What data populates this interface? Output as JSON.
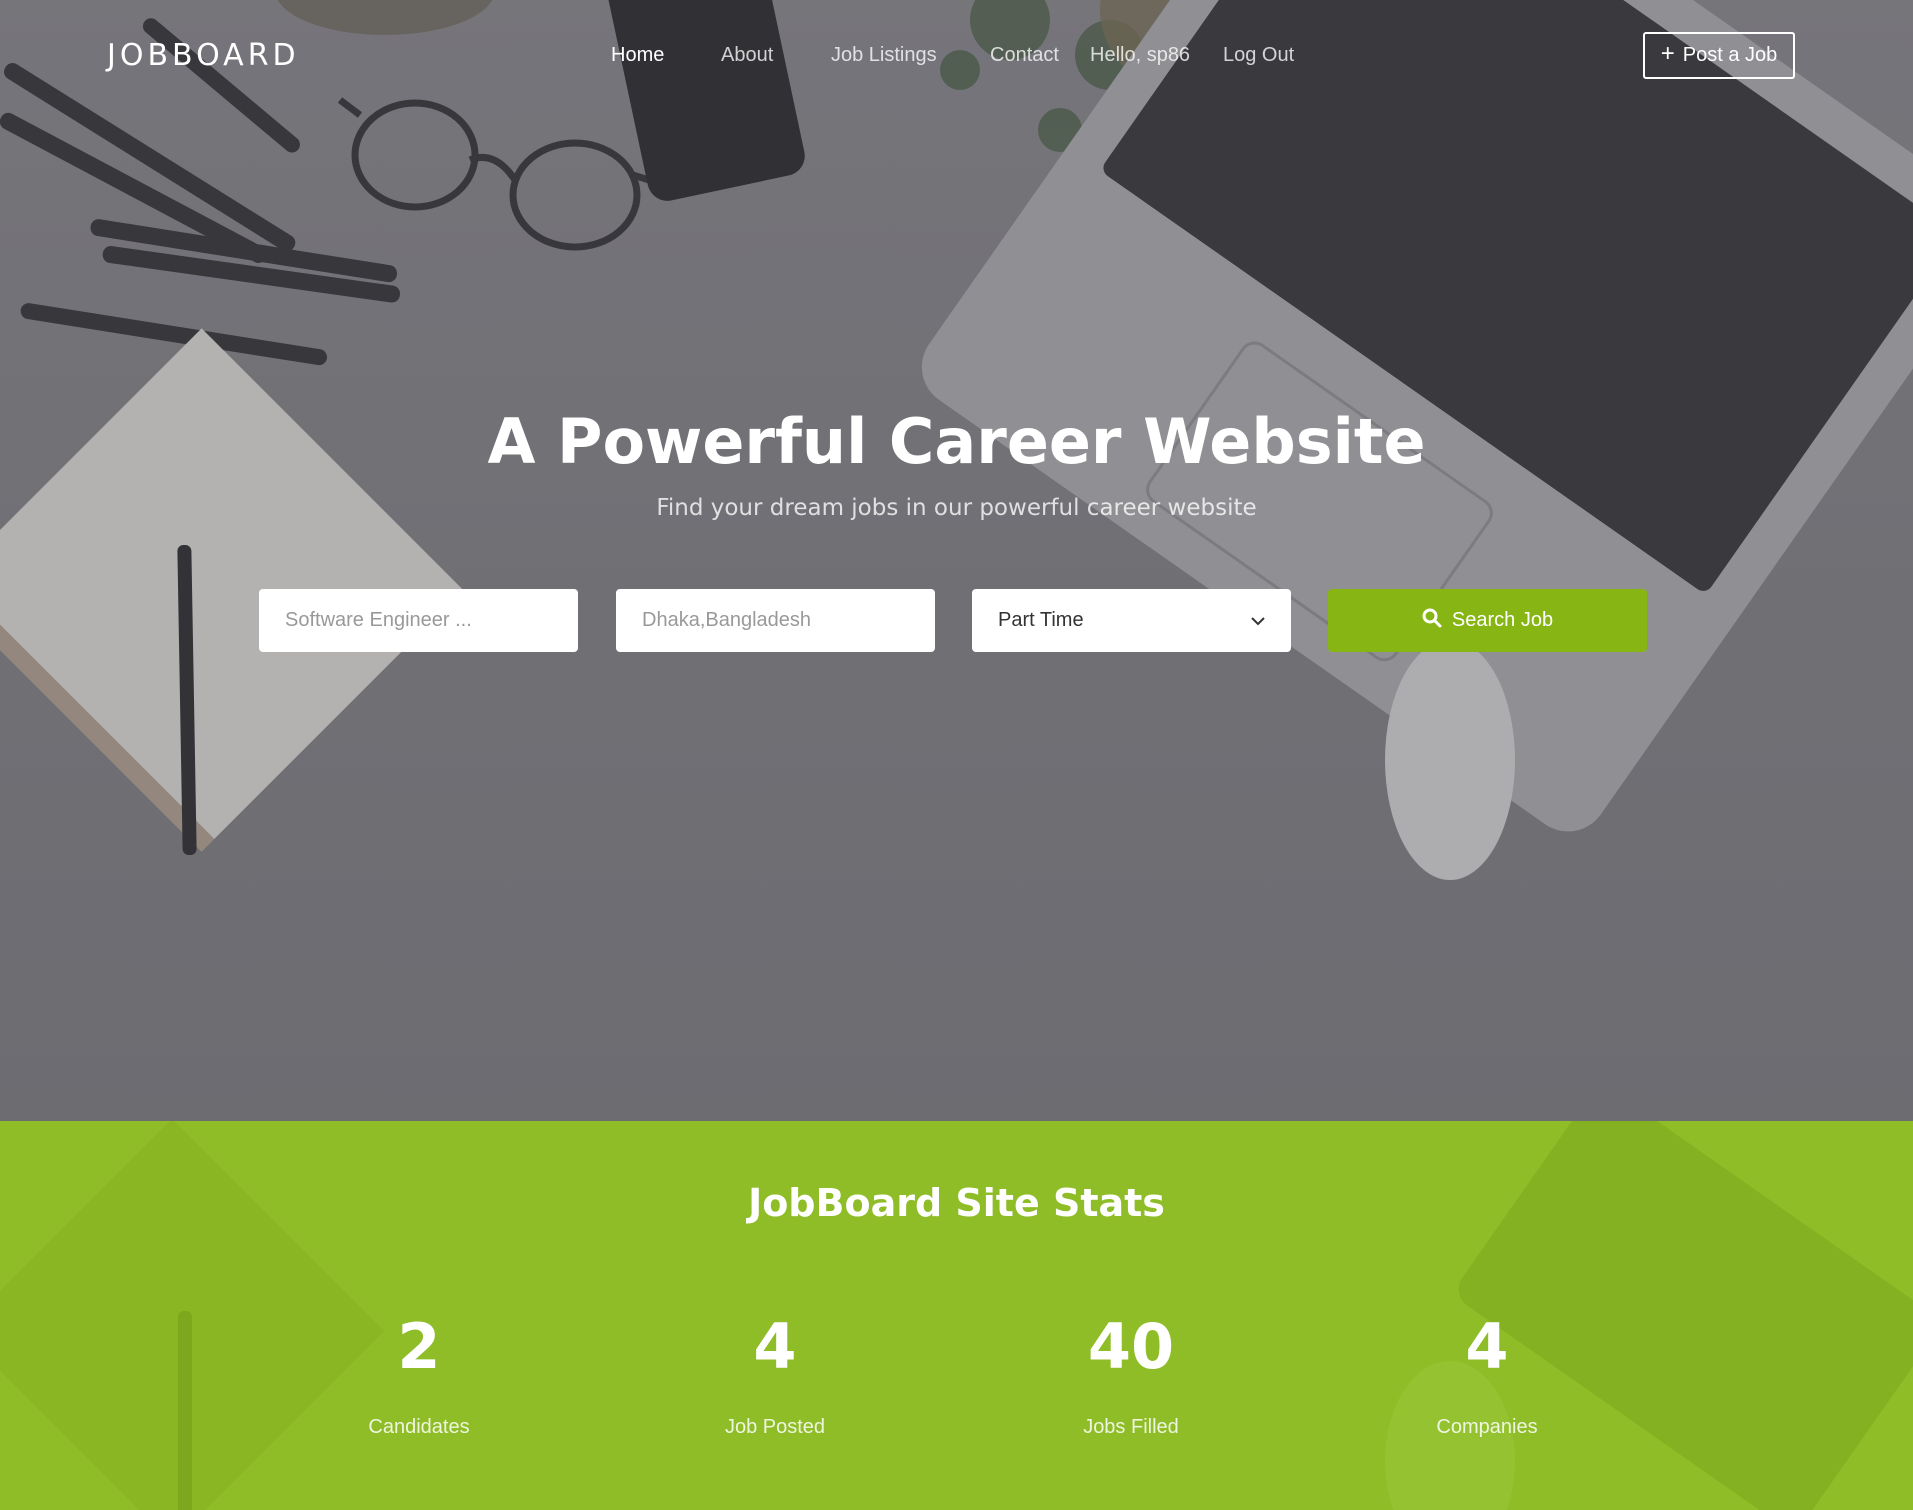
{
  "brand": {
    "logo": "JOBBOARD"
  },
  "nav": {
    "items": [
      {
        "label": "Home",
        "active": true
      },
      {
        "label": "About",
        "active": false
      },
      {
        "label": "Job Listings",
        "active": false
      },
      {
        "label": "Contact",
        "active": false
      },
      {
        "label": "Hello, sp86",
        "active": false
      },
      {
        "label": "Log Out",
        "active": false
      }
    ],
    "post_job_label": "Post a Job"
  },
  "hero": {
    "title": "A Powerful Career Website",
    "subtitle": "Find your dream jobs in our powerful career website"
  },
  "search": {
    "keyword_placeholder": "Software Engineer ...",
    "location_placeholder": "Dhaka,Bangladesh",
    "job_type_selected": "Part Time",
    "button_label": "Search Job"
  },
  "stats": {
    "title": "JobBoard Site Stats",
    "items": [
      {
        "value": "2",
        "label": "Candidates"
      },
      {
        "value": "4",
        "label": "Job Posted"
      },
      {
        "value": "40",
        "label": "Jobs Filled"
      },
      {
        "value": "4",
        "label": "Companies"
      }
    ]
  },
  "colors": {
    "accent": "#87b513",
    "stats_bg": "#8fbd27",
    "hero_overlay": "#727176"
  },
  "icons": {
    "post_job": "plus-icon",
    "search_button": "search-icon",
    "select": "chevron-down-icon"
  }
}
